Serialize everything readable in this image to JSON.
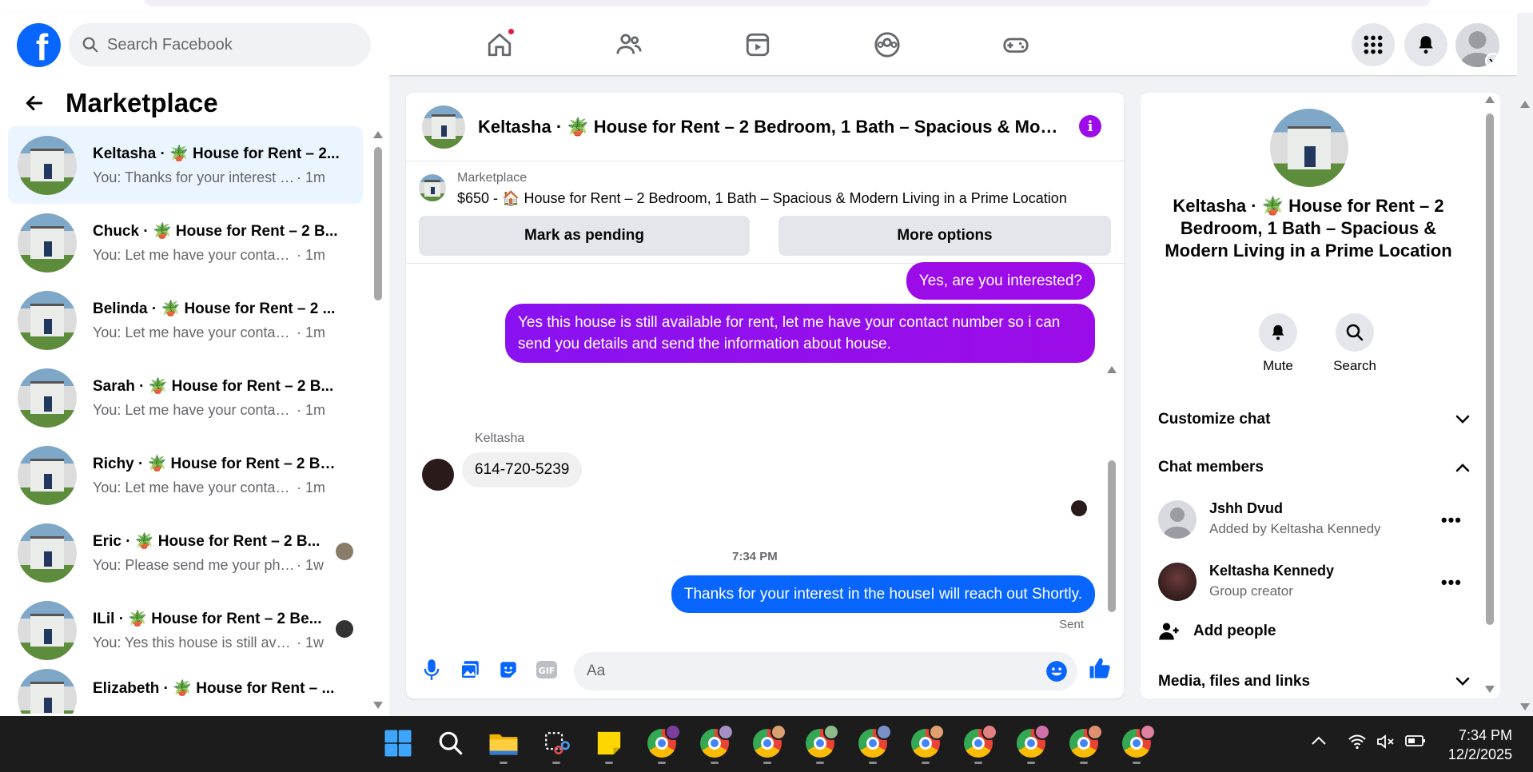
{
  "header": {
    "logo_letter": "f",
    "search_placeholder": "Search Facebook"
  },
  "left": {
    "title": "Marketplace",
    "conversations": [
      {
        "name": "Keltasha · 🪴 House for Rent – 2...",
        "snippet": "You: Thanks for your interest in th...",
        "time": "· 1m",
        "active": true
      },
      {
        "name": "Chuck · 🪴 House for Rent – 2 B...",
        "snippet": "You: Let me have your contact nu...",
        "time": "· 1m"
      },
      {
        "name": "Belinda · 🪴 House for Rent – 2 ...",
        "snippet": "You: Let me have your contact nu...",
        "time": "· 1m"
      },
      {
        "name": "Sarah · 🪴 House for Rent – 2 B...",
        "snippet": "You: Let me have your contact nu...",
        "time": "· 1m"
      },
      {
        "name": "Richy · 🪴 House for Rent – 2 Be...",
        "snippet": "You: Let me have your contact nu...",
        "time": "· 1m"
      },
      {
        "name": "Eric · 🪴 House for Rent – 2 B...",
        "snippet": "You: Please send me your phon...",
        "time": "· 1w"
      },
      {
        "name": "ILil · 🪴 House for Rent – 2 Be...",
        "snippet": "You: Yes this house is still availa...",
        "time": "· 1w"
      },
      {
        "name": "Elizabeth · 🪴 House for Rent – ...",
        "snippet": "",
        "time": ""
      }
    ]
  },
  "chat": {
    "title": "Keltasha · 🪴 House for Rent – 2 Bedroom, 1 Bath – Spacious & Mod···",
    "listing_label": "Marketplace",
    "listing_price": "$650 - 🏠 House for Rent – 2 Bedroom, 1 Bath – Spacious & Modern Living in a Prime Location",
    "mark_pending": "Mark as pending",
    "more_options": "More options",
    "msg1": "Yes, are you interested?",
    "msg2": "Yes this house is still available for rent, let me have your contact number so i can send you details and send the information about house.",
    "sender": "Keltasha",
    "incoming": "614-720-5239",
    "time": "7:34 PM",
    "msg3": "Thanks for your interest in the houseI will reach out Shortly.",
    "sent": "Sent",
    "composer_placeholder": "Aa"
  },
  "right": {
    "name": "Keltasha · 🪴 House for Rent – 2 Bedroom, 1 Bath – Spacious & Modern Living in a Prime Location",
    "mute": "Mute",
    "search": "Search",
    "customize": "Customize chat",
    "members_title": "Chat members",
    "members": [
      {
        "name": "Jshh Dvud",
        "sub": "Added by Keltasha Kennedy"
      },
      {
        "name": "Keltasha Kennedy",
        "sub": "Group creator"
      }
    ],
    "add_people": "Add people",
    "media": "Media, files and links"
  },
  "taskbar": {
    "time": "7:34 PM",
    "date": "12/2/2025"
  },
  "colors": {
    "brand": "#0866ff",
    "bubble_purple": "#9b0ce8",
    "bubble_blue": "#0866ff"
  }
}
